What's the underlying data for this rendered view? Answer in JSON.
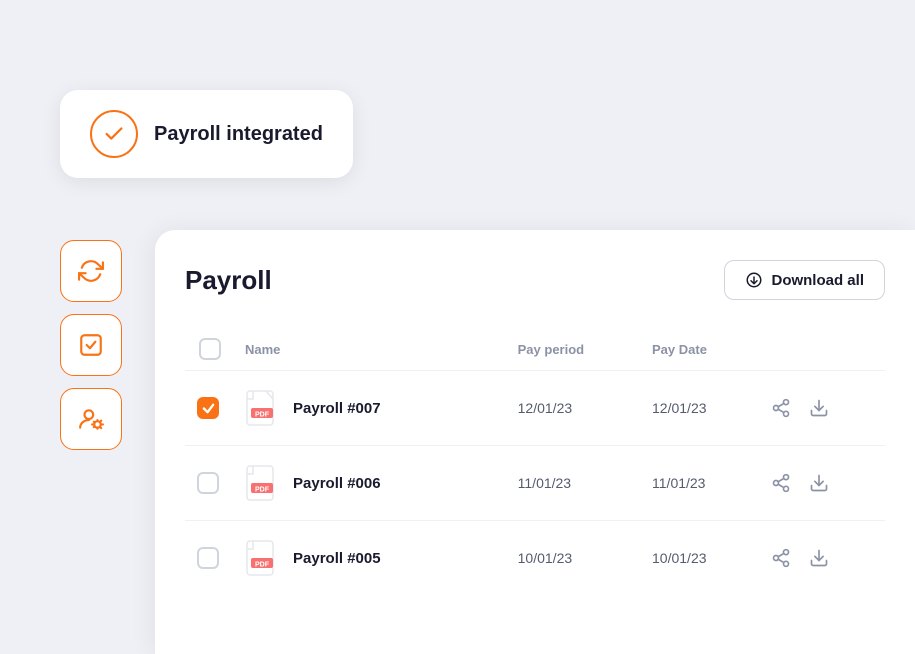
{
  "integration": {
    "title": "Payroll integrated"
  },
  "sidebar": {
    "icons": [
      {
        "name": "sync-icon",
        "type": "sync"
      },
      {
        "name": "checklist-icon",
        "type": "checklist"
      },
      {
        "name": "user-settings-icon",
        "type": "user-settings"
      }
    ]
  },
  "panel": {
    "title": "Payroll",
    "download_all_label": "Download all",
    "table": {
      "headers": [
        "",
        "Name",
        "",
        "Pay period",
        "Pay Date",
        ""
      ],
      "rows": [
        {
          "checked": true,
          "name": "Payroll #007",
          "pay_period": "12/01/23",
          "pay_date": "12/01/23"
        },
        {
          "checked": false,
          "name": "Payroll #006",
          "pay_period": "11/01/23",
          "pay_date": "11/01/23"
        },
        {
          "checked": false,
          "name": "Payroll #005",
          "pay_period": "10/01/23",
          "pay_date": "10/01/23"
        }
      ]
    }
  }
}
